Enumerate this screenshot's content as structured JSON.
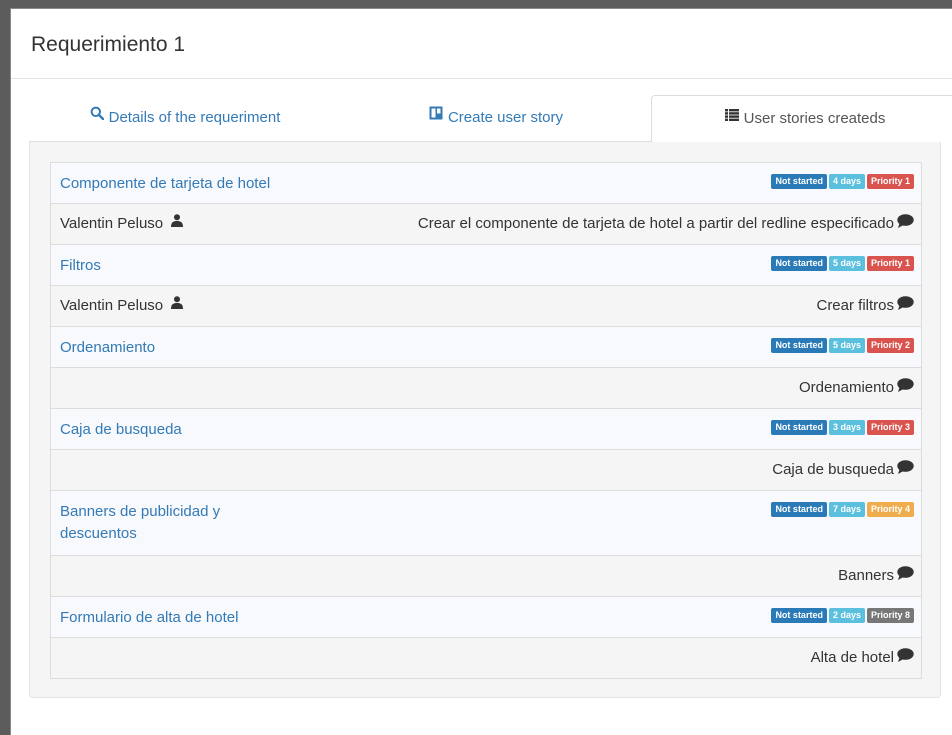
{
  "modal": {
    "title": "Requerimiento 1"
  },
  "tabs": [
    {
      "label": "Details of the requeriment",
      "icon": "search-icon"
    },
    {
      "label": "Create user story",
      "icon": "board-icon"
    },
    {
      "label": "User stories createds",
      "icon": "list-icon",
      "active": true
    }
  ],
  "stories": [
    {
      "title": "Componente de tarjeta de hotel",
      "status": "Not started",
      "days": "4 days",
      "priority": "Priority 1",
      "priority_color": "#d9534f",
      "assignee": "Valentin Peluso",
      "description": "Crear el componente de tarjeta de hotel a partir del redline especificado"
    },
    {
      "title": "Filtros",
      "status": "Not started",
      "days": "5 days",
      "priority": "Priority 1",
      "priority_color": "#d9534f",
      "assignee": "Valentin Peluso",
      "description": "Crear filtros"
    },
    {
      "title": "Ordenamiento",
      "status": "Not started",
      "days": "5 days",
      "priority": "Priority 2",
      "priority_color": "#d9534f",
      "assignee": "",
      "description": "Ordenamiento"
    },
    {
      "title": "Caja de busqueda",
      "status": "Not started",
      "days": "3 days",
      "priority": "Priority 3",
      "priority_color": "#d9534f",
      "assignee": "",
      "description": "Caja de busqueda"
    },
    {
      "title": "Banners de publicidad y descuentos",
      "status": "Not started",
      "days": "7 days",
      "priority": "Priority 4",
      "priority_color": "#f0ad4e",
      "assignee": "",
      "description": "Banners"
    },
    {
      "title": "Formulario de alta de hotel",
      "status": "Not started",
      "days": "2 days",
      "priority": "Priority 8",
      "priority_color": "#777777",
      "assignee": "",
      "description": "Alta de hotel"
    }
  ],
  "colors": {
    "link": "#337ab7",
    "status_badge": "#2a7ab8",
    "days_badge": "#5bc0de"
  }
}
